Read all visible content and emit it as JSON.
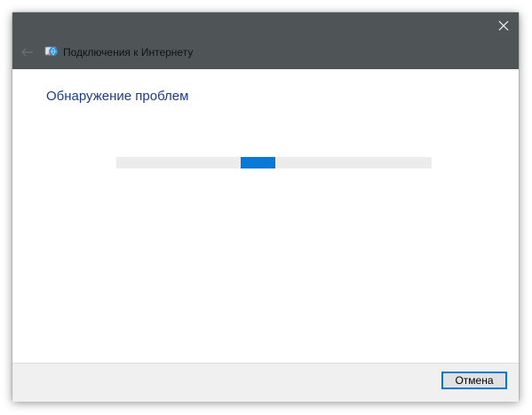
{
  "window": {
    "title": "Подключения к Интернету"
  },
  "main": {
    "heading": "Обнаружение проблем"
  },
  "footer": {
    "cancel_label": "Отмена"
  },
  "icons": {
    "close": "close-icon",
    "back": "back-arrow-icon",
    "app": "network-troubleshooter-icon"
  },
  "colors": {
    "titlebar": "#4f5556",
    "heading": "#1a3d8a",
    "progress_chunk": "#0a78d7",
    "progress_track": "#ececec",
    "button_border": "#0078d7"
  },
  "progress": {
    "type": "marquee",
    "chunk_start_percent": 39.4
  }
}
